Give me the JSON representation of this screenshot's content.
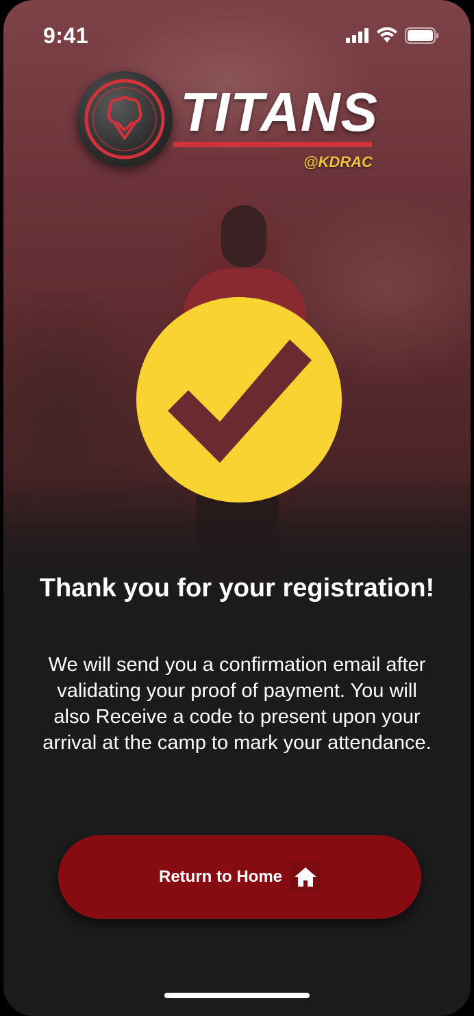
{
  "status_bar": {
    "time": "9:41",
    "icons": [
      "signal-icon",
      "wifi-icon",
      "battery-icon"
    ]
  },
  "logo": {
    "name": "TITANS",
    "handle": "@KDRAC",
    "badge_icon": "titans-emblem-icon"
  },
  "success": {
    "icon": "checkmark-icon",
    "title": "Thank you for your registration!",
    "message": "We will send you a confirmation email after validating your proof of payment. You will also Receive a code to present upon your arrival at the camp to mark your attendance."
  },
  "actions": {
    "return_home_label": "Return to Home",
    "return_home_icon": "home-icon"
  },
  "colors": {
    "accent_yellow": "#f9d331",
    "button_red": "#860c12",
    "brand_red": "#d2333a",
    "handle_gold": "#e9c33a",
    "background_dark": "#1c1b1c"
  }
}
